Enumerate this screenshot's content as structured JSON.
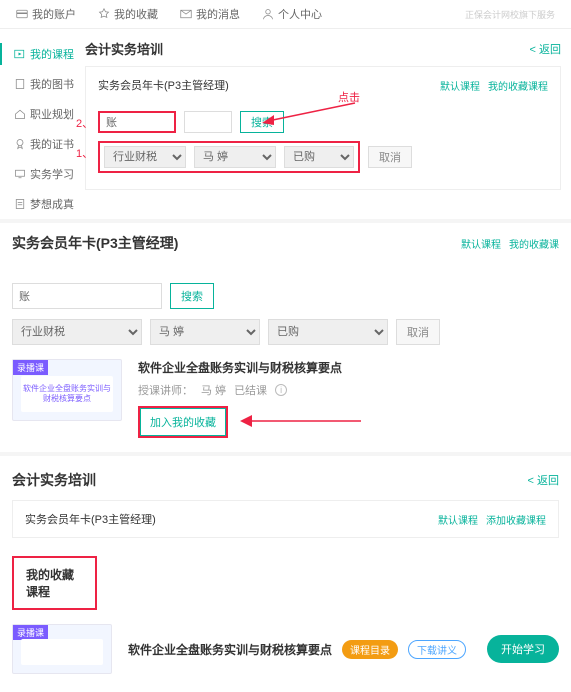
{
  "topnav": {
    "items": [
      {
        "label": "我的账户",
        "icon": "card"
      },
      {
        "label": "我的收藏",
        "icon": "star"
      },
      {
        "label": "我的消息",
        "icon": "mail"
      },
      {
        "label": "个人中心",
        "icon": "user"
      }
    ],
    "brand_note": "正保会计网校旗下服务"
  },
  "sidebar": {
    "items": [
      {
        "label": "我的课程",
        "icon": "video"
      },
      {
        "label": "我的图书",
        "icon": "book"
      },
      {
        "label": "职业规划",
        "icon": "home"
      },
      {
        "label": "我的证书",
        "icon": "medal"
      },
      {
        "label": "实务学习",
        "icon": "tv"
      },
      {
        "label": "梦想成真",
        "icon": "doc"
      }
    ]
  },
  "panel1": {
    "heading": "会计实务培训",
    "back": "< 返回",
    "subtitle": "实务会员年卡(P3主管经理)",
    "links": {
      "a": "默认课程",
      "b": "我的收藏课程"
    },
    "search": {
      "value": "账",
      "button": "搜索"
    },
    "selects": {
      "s1": "行业财税",
      "s2": "马 婷",
      "s3": "已购"
    },
    "cancel": "取消",
    "anno_num1": "1、",
    "anno_num2": "2、",
    "anno_click": "点击"
  },
  "panel2": {
    "title": "实务会员年卡(P3主管经理)",
    "links": {
      "a": "默认课程",
      "b": "我的收藏课"
    },
    "search": {
      "value": "账",
      "button": "搜索"
    },
    "selects": {
      "s1": "行业财税",
      "s2": "马 婷",
      "s3": "已购"
    },
    "cancel": "取消",
    "course": {
      "thumb_badge": "录播课",
      "thumb_text": "软件企业全盘账务实训与财税核算要点",
      "title": "软件企业全盘账务实训与财税核算要点",
      "teacher_label": "授课讲师：",
      "teacher": "马 婷",
      "ended": "已结课",
      "fav_button": "加入我的收藏"
    }
  },
  "panel3": {
    "heading": "会计实务培训",
    "back": "< 返回",
    "subtitle": "实务会员年卡(P3主管经理)",
    "links": {
      "a": "默认课程",
      "b": "添加收藏课程"
    },
    "fav_heading": "我的收藏课程",
    "course": {
      "thumb_badge": "录播课",
      "title": "软件企业全盘账务实训与财税核算要点",
      "pill_catalog": "课程目录",
      "pill_dl": "下载讲义",
      "start": "开始学习"
    }
  }
}
